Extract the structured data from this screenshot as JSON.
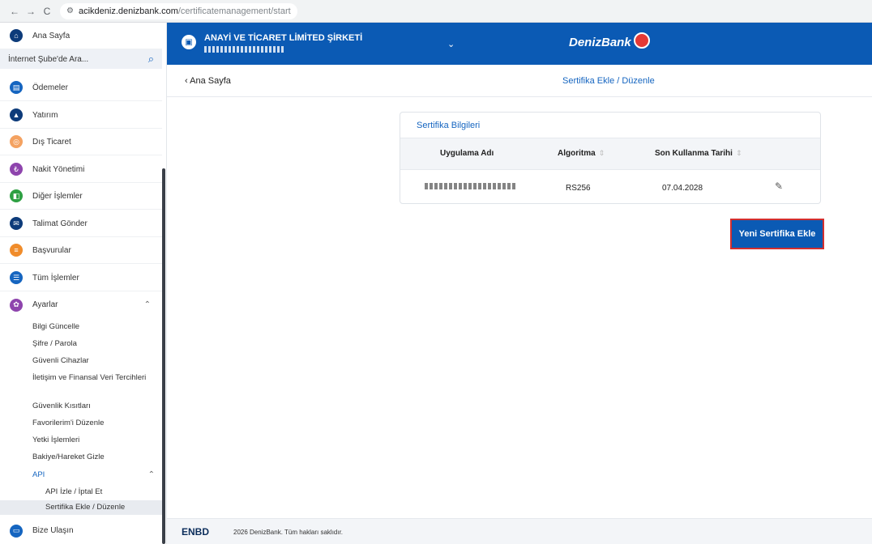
{
  "browser": {
    "back": "←",
    "forward": "→",
    "reload": "C",
    "host": "acikdeniz.denizbank.com",
    "path": "/certificatemanagement/start"
  },
  "sidebar": {
    "home_label": "Ana Sayfa",
    "search_placeholder": "İnternet Şube'de Ara...",
    "items": [
      {
        "label": "Ödemeler",
        "color": "#1565c0"
      },
      {
        "label": "Yatırım",
        "color": "#0d3b7a"
      },
      {
        "label": "Dış Ticaret",
        "color": "#f4a261"
      },
      {
        "label": "Nakit Yönetimi",
        "color": "#8e44ad"
      },
      {
        "label": "Diğer İşlemler",
        "color": "#2ea043"
      },
      {
        "label": "Talimat Gönder",
        "color": "#0d3b7a"
      },
      {
        "label": "Başvurular",
        "color": "#f08c2b"
      },
      {
        "label": "Tüm İşlemler",
        "color": "#1565c0"
      },
      {
        "label": "Ayarlar",
        "color": "#8e44ad"
      }
    ],
    "settings_subitems": [
      "Bilgi Güncelle",
      "Şifre / Parola",
      "Güvenli Cihazlar",
      "İletişim ve Finansal Veri Tercihleri",
      "Güvenlik Kısıtları",
      "Favorilerim'i Düzenle",
      "Yetki İşlemleri",
      "Bakiye/Hareket Gizle"
    ],
    "api_label": "API",
    "api_subitems": [
      "API İzle / İptal Et",
      "Sertifika Ekle / Düzenle"
    ],
    "contact_label": "Bize Ulaşın"
  },
  "topbar": {
    "org_name": "ANAYİ VE TİCARET LİMİTED ŞİRKETİ",
    "brand": "DenizBank"
  },
  "subheader": {
    "back_label": "Ana Sayfa",
    "title": "Sertifika Ekle / Düzenle"
  },
  "certificates": {
    "card_title": "Sertifika Bilgileri",
    "columns": [
      "Uygulama Adı",
      "Algoritma",
      "Son Kullanma Tarihi"
    ],
    "rows": [
      {
        "algorithm": "RS256",
        "expiry": "07.04.2028"
      }
    ],
    "add_button": "Yeni Sertifika Ekle"
  },
  "footer": {
    "logo": "ENBD",
    "copyright": "2026 DenizBank. Tüm hakları saklıdır."
  }
}
